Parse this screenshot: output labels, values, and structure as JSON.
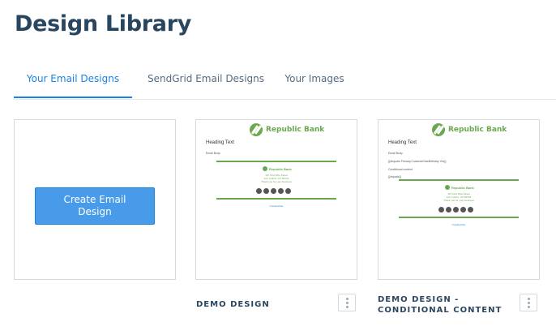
{
  "header": {
    "title": "Design Library"
  },
  "tabs": [
    {
      "label": "Your Email Designs",
      "active": true
    },
    {
      "label": "SendGrid Email Designs",
      "active": false
    },
    {
      "label": "Your Images",
      "active": false
    }
  ],
  "create": {
    "label": "Create Email Design"
  },
  "designs": [
    {
      "name": "DEMO DESIGN",
      "thumbnail": {
        "brand": "Republic Bank",
        "heading": "Heading Text",
        "body": "Email Body",
        "footer_brand": "Republic Bank",
        "address_1": "197 First Wire Street",
        "address_2": "Fort Collins, CO 80733",
        "address_3": "Thank you for your business",
        "unsubscribe": "Unsubscribe"
      }
    },
    {
      "name": "DEMO DESIGN - CONDITIONAL CONTENT",
      "thumbnail": {
        "brand": "Republic Bank",
        "heading": "Heading Text",
        "body": "Email Body",
        "line_1": "{{#equals Primary.CustomerHasBirthday Yes}}",
        "line_2": "Conditional content",
        "line_3": "{{/equals}}",
        "footer_brand": "Republic Bank",
        "address_1": "197 First Wire Street",
        "address_2": "Fort Collins, CO 80733",
        "address_3": "Thank you for your business",
        "unsubscribe": "Unsubscribe"
      }
    }
  ],
  "colors": {
    "accent": "#1a82e2",
    "button": "#489be8",
    "brand_green": "#6aa84f",
    "title": "#294661"
  }
}
